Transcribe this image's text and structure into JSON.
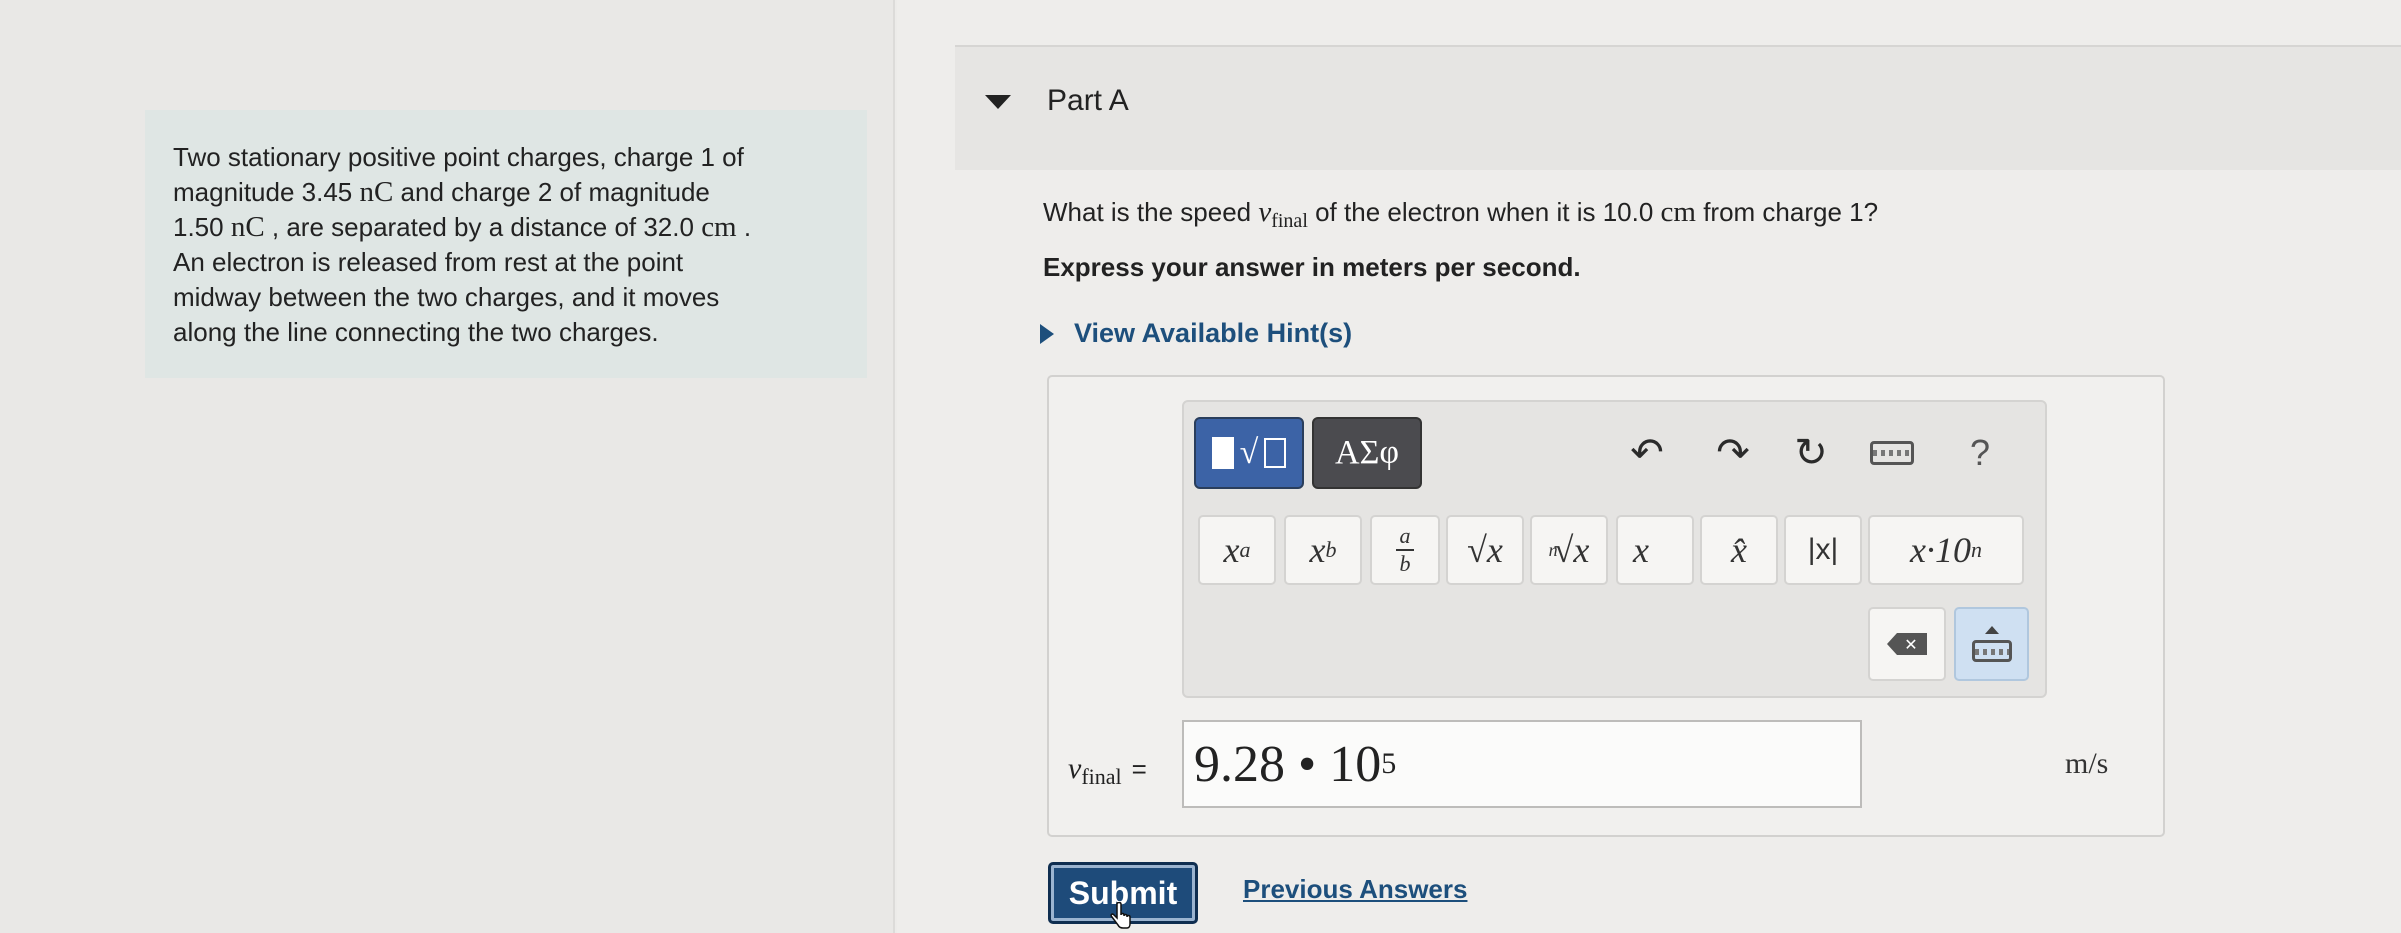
{
  "problem": {
    "line1": "Two stationary positive point charges, charge 1 of",
    "line2_pre": "magnitude 3.45 ",
    "line2_unit": "nC",
    "line2_post": " and charge 2 of magnitude",
    "line3_pre": "1.50 ",
    "line3_unit": "nC",
    "line3_mid": " , are separated by a distance of 32.0 ",
    "line3_unit2": "cm",
    "line3_post": " .",
    "line4": "An electron is released from rest at the point",
    "line5": "midway between the two charges, and it moves",
    "line6": "along the line connecting the two charges."
  },
  "part": {
    "title": "Part A"
  },
  "question": {
    "pre": "What is the speed ",
    "var": "v",
    "sub": "final",
    "mid": " of the electron when it is 10.0 ",
    "unit": "cm",
    "post": " from charge 1?",
    "instruction": "Express your answer in meters per second."
  },
  "hints": {
    "label": "View Available Hint(s)"
  },
  "toolbar": {
    "templates_label": "√",
    "greek_label": "ΑΣφ",
    "undo": "↶",
    "redo": "↷",
    "reset": "↻",
    "help": "?",
    "keys": {
      "power_base": "x",
      "power_exp": "a",
      "subscript_base": "x",
      "subscript_sub": "b",
      "frac_num": "a",
      "frac_den": "b",
      "sqrt": "√x",
      "nroot_index": "n",
      "nroot": "√x",
      "vector": "x⃗",
      "unit_vector": "x̂",
      "abs": "|x|",
      "sci": "x·10",
      "sci_exp": "n"
    },
    "backspace": "✕"
  },
  "answer": {
    "label_var": "v",
    "label_sub": "final",
    "label_eq": "=",
    "value_mantissa": "9.28 • 10",
    "value_exp": "5",
    "units": "m/s"
  },
  "actions": {
    "submit": "Submit",
    "previous_answers": "Previous Answers"
  },
  "colors": {
    "link": "#1d4f7c",
    "submit_bg": "#1e4b7a",
    "templates_bg": "#3c63a6",
    "greek_bg": "#4b4b4f",
    "problem_bg": "#dfe6e4"
  }
}
